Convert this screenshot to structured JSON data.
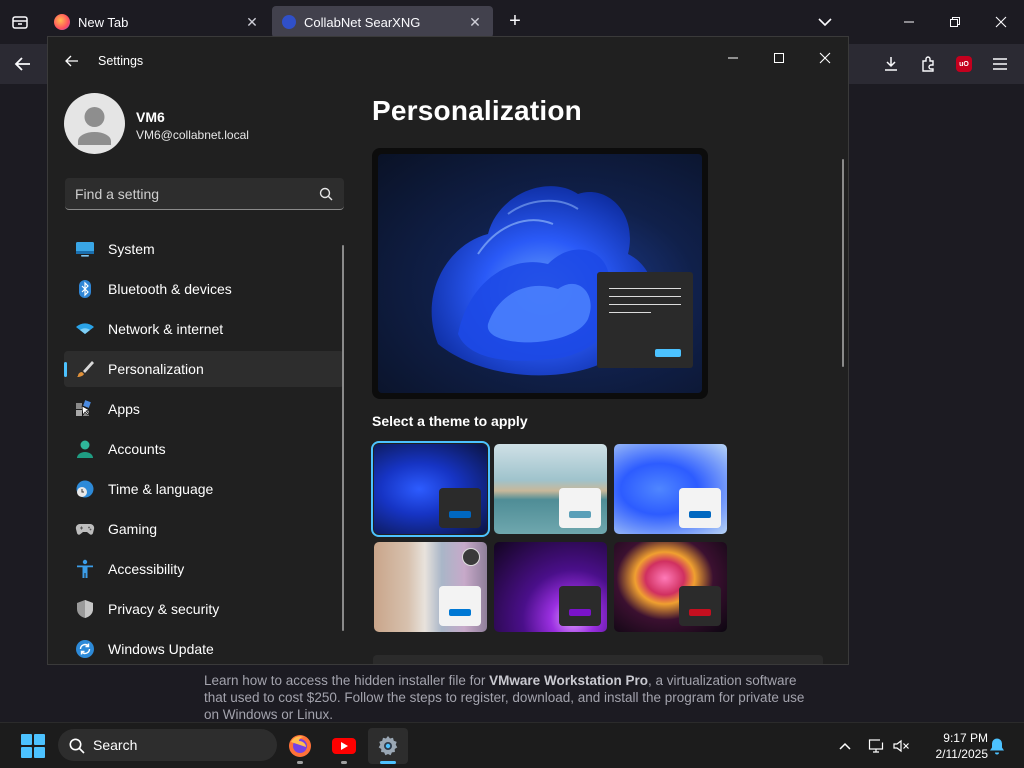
{
  "browser": {
    "tabs": [
      {
        "title": "New Tab",
        "favicon": "firefox-icon"
      },
      {
        "title": "CollabNet SearXNG",
        "favicon": "searxng-icon"
      }
    ],
    "toolbar_icons": [
      "back-icon",
      "download-icon",
      "extensions-icon",
      "ublock-icon",
      "menu-icon"
    ],
    "ublock_label": "uO"
  },
  "page": {
    "snippet_pre": "Learn how to access the hidden installer file for ",
    "snippet_bold": "VMware Workstation Pro",
    "snippet_post": ", a virtualization software that used to cost $250. Follow the steps to register, download, and install the program for private use on Windows or Linux."
  },
  "settings": {
    "window_title": "Settings",
    "user": {
      "name": "VM6",
      "email": "VM6@collabnet.local"
    },
    "search_placeholder": "Find a setting",
    "nav": [
      {
        "label": "System",
        "icon": "system-icon"
      },
      {
        "label": "Bluetooth & devices",
        "icon": "bluetooth-icon"
      },
      {
        "label": "Network & internet",
        "icon": "wifi-icon"
      },
      {
        "label": "Personalization",
        "icon": "brush-icon",
        "active": true
      },
      {
        "label": "Apps",
        "icon": "apps-icon"
      },
      {
        "label": "Accounts",
        "icon": "person-icon"
      },
      {
        "label": "Time & language",
        "icon": "globe-clock-icon"
      },
      {
        "label": "Gaming",
        "icon": "gamepad-icon"
      },
      {
        "label": "Accessibility",
        "icon": "accessibility-icon"
      },
      {
        "label": "Privacy & security",
        "icon": "shield-icon"
      },
      {
        "label": "Windows Update",
        "icon": "update-icon"
      }
    ],
    "page_title": "Personalization",
    "themes_heading": "Select a theme to apply",
    "themes": [
      {
        "name": "windows-dark",
        "accent": "#0067c0",
        "selected": true
      },
      {
        "name": "glow-lake",
        "accent": "#5a9fb8"
      },
      {
        "name": "windows-light",
        "accent": "#0067c0"
      },
      {
        "name": "spotlight-blossom",
        "accent": "#0078d4"
      },
      {
        "name": "glow-purple",
        "accent": "#7a13c9"
      },
      {
        "name": "flow-red",
        "accent": "#c50f1f"
      }
    ],
    "accent_color": "#4cc2ff"
  },
  "taskbar": {
    "search_label": "Search",
    "apps": [
      "firefox-icon",
      "youtube-icon",
      "settings-gear-icon"
    ],
    "time": "9:17 PM",
    "date": "2/11/2025"
  }
}
